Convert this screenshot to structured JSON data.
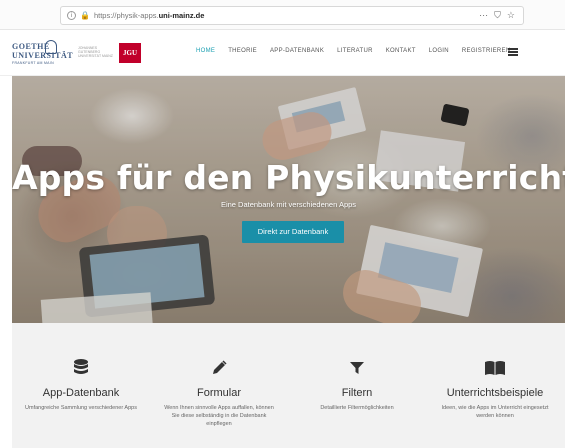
{
  "browser": {
    "url_prefix": "https://physik-apps.",
    "url_domain": "uni-mainz.de",
    "actions": [
      "···",
      "⛉",
      "☆"
    ]
  },
  "logos": {
    "goethe_line1": "GOETHE",
    "goethe_line2": "UNIVERSITÄT",
    "goethe_line3": "FRANKFURT AM MAIN",
    "jgu_text": "JOHANNES GUTENBERG UNIVERSITÄT MAINZ",
    "jgu_mark": "JGU"
  },
  "nav": {
    "items": [
      {
        "label": "HOME",
        "active": true
      },
      {
        "label": "THEORIE"
      },
      {
        "label": "APP-DATENBANK"
      },
      {
        "label": "LITERATUR"
      },
      {
        "label": "KONTAKT"
      },
      {
        "label": "LOGIN"
      },
      {
        "label": "REGISTRIEREN"
      }
    ]
  },
  "hero": {
    "title": "Apps für den Physikunterricht",
    "subtitle": "Eine Datenbank mit verschiedenen Apps",
    "button_label": "Direkt zur Datenbank"
  },
  "features": [
    {
      "icon": "database-icon",
      "title": "App-Datenbank",
      "text": "Umfangreiche Sammlung verschiedener Apps"
    },
    {
      "icon": "pencil-icon",
      "title": "Formular",
      "text": "Wenn Ihnen sinnvolle Apps auffallen, können Sie diese selbständig in die Datenbank einpflegen"
    },
    {
      "icon": "filter-icon",
      "title": "Filtern",
      "text": "Detaillierte Filtermöglichkeiten"
    },
    {
      "icon": "book-icon",
      "title": "Unterrichtsbeispiele",
      "text": "Ideen, wie die Apps im Unterricht eingesetzt werden können"
    }
  ],
  "colors": {
    "accent": "#1a9fb2",
    "button": "#1a8fa8",
    "jgu_red": "#c1002a",
    "goethe_blue": "#3e5a82"
  }
}
